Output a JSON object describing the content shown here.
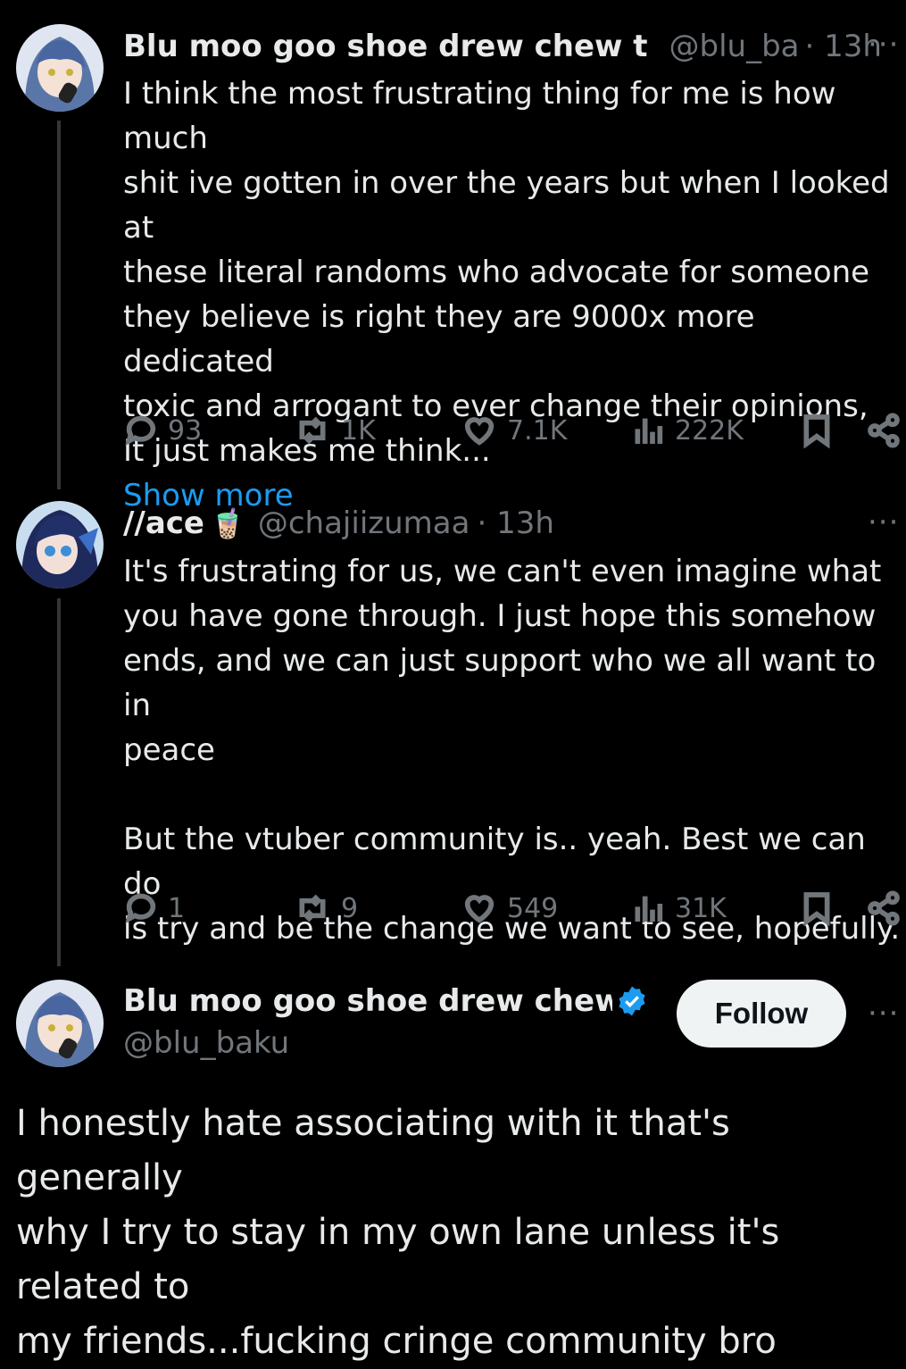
{
  "tweets": [
    {
      "author": "Blu moo goo shoe drew chew t",
      "handle": "@blu_ba",
      "time": "· 13h",
      "more": "···",
      "lines": [
        "I think the most frustrating thing for me is how much",
        "shit ive gotten in over the years but when I looked at",
        "these literal randoms who advocate for someone",
        "they believe is right they are 9000x more dedicated",
        "toxic and arrogant to ever change their opinions,",
        "It just makes me think..."
      ],
      "show_more": "Show more",
      "stats": {
        "replies": "93",
        "reposts": "1K",
        "likes": "7.1K",
        "views": "222K"
      }
    },
    {
      "author": "//ace",
      "emoji": "🧋",
      "handle": "@chajiizumaa",
      "time": "· 13h",
      "more": "···",
      "lines": [
        "It's frustrating for us, we can't even imagine what",
        "you have gone through. I just hope this somehow",
        "ends, and we can just support who we all want to in",
        "peace",
        "",
        "But the vtuber community is.. yeah. Best we can do",
        "is try and be the change we want to see, hopefully."
      ],
      "stats": {
        "replies": "1",
        "reposts": "9",
        "likes": "549",
        "views": "31K"
      }
    }
  ],
  "main_tweet": {
    "author": "Blu moo goo shoe drew chew tr",
    "handle": "@blu_baku",
    "follow_label": "Follow",
    "more": "···",
    "lines": [
      "I honestly hate associating with it that's generally",
      "why I try to stay in my own lane unless it's related to",
      "my friends...fucking cringe community bro"
    ]
  },
  "colors": {
    "link": "#1d9bf0",
    "muted": "#71767b",
    "verified": "#1d9bf0"
  }
}
